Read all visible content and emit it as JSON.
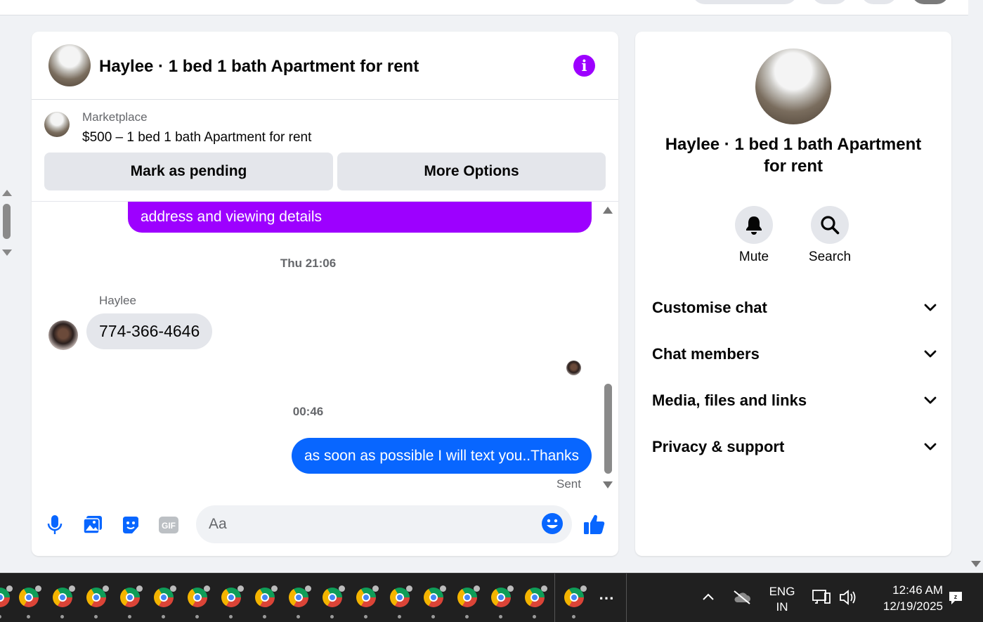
{
  "chat": {
    "title": "Haylee · 1 bed 1 bath Apartment for rent",
    "marketplace": {
      "label": "Marketplace",
      "listing": "$500 – 1 bed 1 bath Apartment for rent",
      "mark_pending_label": "Mark as pending",
      "more_options_label": "More Options"
    },
    "messages": {
      "partial_message_text": "address and viewing details",
      "timestamp_1": "Thu 21:06",
      "sender_name": "Haylee",
      "received_message": "774-366-4646",
      "timestamp_2": "00:46",
      "sent_message": "as soon as possible I will text you..Thanks",
      "sent_status": "Sent"
    },
    "composer": {
      "placeholder": "Aa"
    }
  },
  "panel": {
    "title": "Haylee · 1 bed 1 bath Apartment for rent",
    "actions": [
      {
        "label": "Mute",
        "icon": "bell-icon"
      },
      {
        "label": "Search",
        "icon": "search-icon"
      }
    ],
    "sections": [
      {
        "label": "Customise chat"
      },
      {
        "label": "Chat members"
      },
      {
        "label": "Media, files and links"
      },
      {
        "label": "Privacy & support"
      }
    ]
  },
  "taskbar": {
    "language_line1": "ENG",
    "language_line2": "IN",
    "time": "12:46 AM",
    "date": "12/19/2025"
  },
  "colors": {
    "accent_purple": "#9d00ff",
    "accent_blue": "#0866ff"
  }
}
